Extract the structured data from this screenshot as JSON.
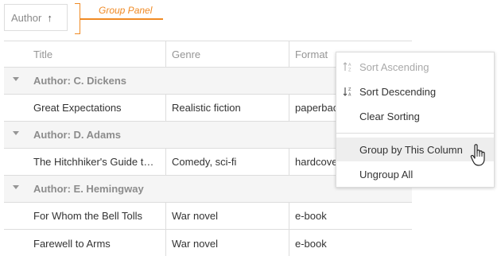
{
  "group_panel": {
    "chip_label": "Author",
    "chip_sort_icon": "arrow-up-icon",
    "callout": "Group Panel",
    "accent_color": "#f08a24"
  },
  "grid": {
    "columns": [
      "Title",
      "Genre",
      "Format"
    ],
    "groups": [
      {
        "label": "Author: C. Dickens",
        "rows": [
          {
            "title": "Great Expectations",
            "genre": "Realistic fiction",
            "format": "paperback"
          }
        ]
      },
      {
        "label": "Author: D. Adams",
        "rows": [
          {
            "title": "The Hitchhiker's Guide to the Galaxy",
            "genre": "Comedy, sci-fi",
            "format": "hardcover"
          }
        ]
      },
      {
        "label": "Author: E. Hemingway",
        "rows": [
          {
            "title": "For Whom the Bell Tolls",
            "genre": "War novel",
            "format": "e-book"
          },
          {
            "title": "Farewell to Arms",
            "genre": "War novel",
            "format": "e-book"
          }
        ]
      }
    ]
  },
  "context_menu": {
    "items": [
      {
        "label": "Sort Ascending",
        "icon": "sort-ascending-icon",
        "disabled": true
      },
      {
        "label": "Sort Descending",
        "icon": "sort-descending-icon",
        "disabled": false
      },
      {
        "label": "Clear Sorting",
        "icon": "",
        "disabled": false
      },
      {
        "label": "Group by This Column",
        "icon": "",
        "disabled": false,
        "hovered": true
      },
      {
        "label": "Ungroup All",
        "icon": "",
        "disabled": false
      }
    ]
  }
}
